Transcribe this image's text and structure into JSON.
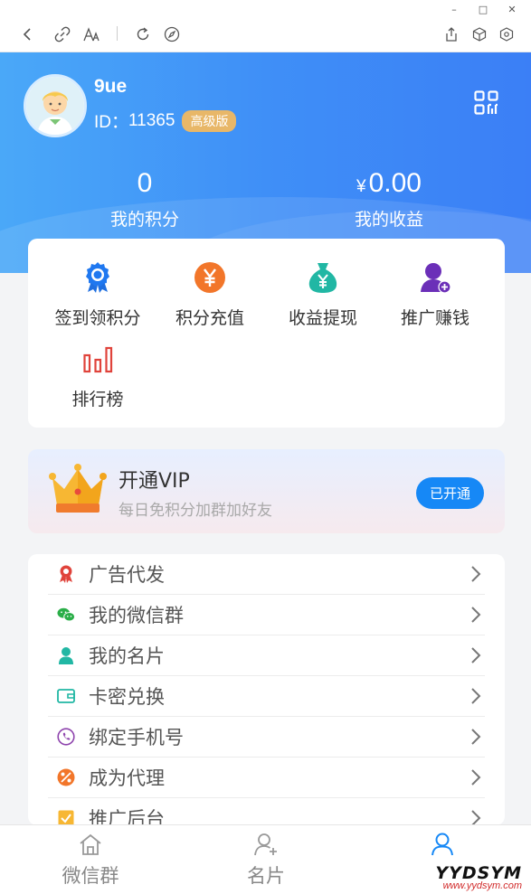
{
  "window": {
    "minimize": "–",
    "maximize": "□",
    "close": "✕"
  },
  "user": {
    "name": "9ue",
    "id_label": "ID：",
    "id_value": "11365",
    "level_badge": "高级版"
  },
  "stats": {
    "points": {
      "value": "0",
      "label": "我的积分"
    },
    "earnings": {
      "currency": "¥",
      "value": "0.00",
      "label": "我的收益"
    }
  },
  "functions": [
    {
      "label": "签到领积分",
      "icon": "medal-icon"
    },
    {
      "label": "积分充值",
      "icon": "yen-circle-icon"
    },
    {
      "label": "收益提现",
      "icon": "money-bag-icon"
    },
    {
      "label": "推广赚钱",
      "icon": "user-add-icon"
    },
    {
      "label": "排行榜",
      "icon": "bar-chart-icon"
    }
  ],
  "vip": {
    "title": "开通VIP",
    "subtitle": "每日免积分加群加好友",
    "button": "已开通"
  },
  "menu": [
    {
      "label": "广告代发",
      "icon": "award-icon"
    },
    {
      "label": "我的微信群",
      "icon": "wechat-icon"
    },
    {
      "label": "我的名片",
      "icon": "person-icon"
    },
    {
      "label": "卡密兑换",
      "icon": "wallet-icon"
    },
    {
      "label": "绑定手机号",
      "icon": "phone-icon"
    },
    {
      "label": "成为代理",
      "icon": "percent-icon"
    },
    {
      "label": "推广后台",
      "icon": "checkbox-icon"
    }
  ],
  "tabs": [
    {
      "label": "微信群",
      "icon": "home-icon"
    },
    {
      "label": "名片",
      "icon": "user-plus-icon"
    },
    {
      "label": "",
      "icon": "user-icon"
    }
  ],
  "watermark": {
    "brand": "YYDSYM",
    "url": "www.yydsym.com"
  },
  "colors": {
    "primary": "#3b82f6",
    "vip_button": "#1688f6",
    "badge": "#e8b768"
  }
}
